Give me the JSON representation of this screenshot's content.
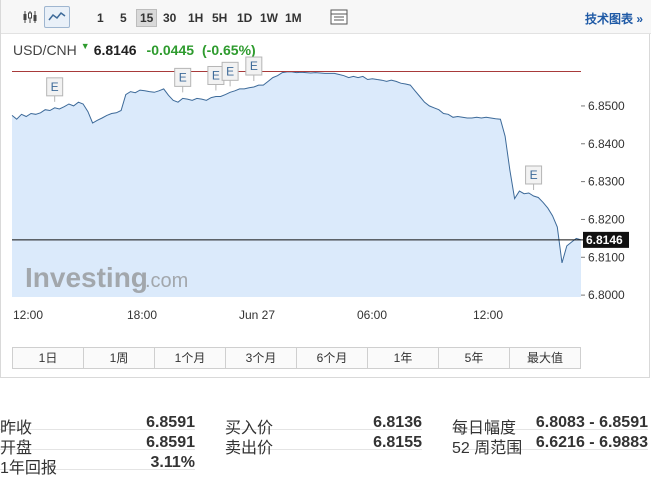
{
  "toolbar": {
    "timeframes": [
      "1",
      "5",
      "15",
      "30",
      "1H",
      "5H",
      "1D",
      "1W",
      "1M"
    ],
    "active_timeframe": "15",
    "tech_chart_link": "技术图表 »"
  },
  "quote": {
    "symbol": "USD/CNH",
    "price": "6.8146",
    "change": "-0.0445",
    "change_pct": "(-0.65%)",
    "up_color": "#2e9b2e"
  },
  "watermark": {
    "brand": "Investing",
    "suffix": ".com"
  },
  "ranges": [
    "1日",
    "1周",
    "1个月",
    "3个月",
    "6个月",
    "1年",
    "5年",
    "最大值"
  ],
  "chart_data": {
    "type": "area",
    "x_ticks": [
      "12:00",
      "18:00",
      "Jun 27",
      "06:00",
      "12:00"
    ],
    "y_ticks": [
      "6.8500",
      "6.8400",
      "6.8300",
      "6.8200",
      "6.8100",
      "6.8000"
    ],
    "ylim": [
      6.7995,
      6.8595
    ],
    "prev_close": 6.8591,
    "current_label": "6.8146",
    "event_marker_label": "E",
    "event_markers": [
      9,
      36,
      43,
      46,
      51,
      110
    ],
    "fill_color": "#dbeafb",
    "line_color": "#3d6a99",
    "prev_close_color": "#a83a3a",
    "grid": false,
    "series": [
      {
        "values": [
          6.8475,
          6.8465,
          6.8478,
          6.8472,
          6.848,
          6.8478,
          6.8482,
          6.849,
          6.8488,
          6.8495,
          6.8492,
          6.8498,
          6.8505,
          6.85,
          6.851,
          6.8505,
          6.8485,
          6.8455,
          6.8462,
          6.8468,
          6.8475,
          6.848,
          6.8482,
          6.8488,
          6.853,
          6.8538,
          6.8535,
          6.8542,
          6.854,
          6.8538,
          6.8536,
          6.854,
          6.8545,
          6.8528,
          6.8515,
          6.851,
          6.852,
          6.8518,
          6.8515,
          6.852,
          6.8518,
          6.8515,
          6.8522,
          6.8525,
          6.8525,
          6.853,
          6.8536,
          6.854,
          6.8545,
          6.8545,
          6.8548,
          6.855,
          6.8555,
          6.8555,
          6.8565,
          6.8575,
          6.858,
          6.8588,
          6.859,
          6.859,
          6.8588,
          6.8589,
          6.8588,
          6.8587,
          6.8588,
          6.8587,
          6.8586,
          6.8586,
          6.8586,
          6.8583,
          6.858,
          6.8575,
          6.8578,
          6.8575,
          6.8578,
          6.857,
          6.8572,
          6.857,
          6.8568,
          6.8565,
          6.8568,
          6.8565,
          6.856,
          6.8558,
          6.8555,
          6.854,
          6.8525,
          6.851,
          6.85,
          6.8495,
          6.849,
          6.848,
          6.8478,
          6.847,
          6.8472,
          6.847,
          6.8468,
          6.8468,
          6.847,
          6.8468,
          6.847,
          6.8468,
          6.8466,
          6.8465,
          6.842,
          6.833,
          6.8255,
          6.8275,
          6.8268,
          6.827,
          6.8262,
          6.8258,
          6.8245,
          6.823,
          6.821,
          6.818,
          6.8085,
          6.813,
          6.814,
          6.815,
          6.8146
        ]
      }
    ]
  },
  "stats": {
    "prev_close": {
      "label": "昨收",
      "value": "6.8591"
    },
    "open": {
      "label": "开盘",
      "value": "6.8591"
    },
    "year_change": {
      "label": "1年回报",
      "value": "3.11%"
    },
    "bid": {
      "label": "买入价",
      "value": "6.8136"
    },
    "ask": {
      "label": "卖出价",
      "value": "6.8155"
    },
    "day_range": {
      "label": "每日幅度",
      "value": "6.8083 - 6.8591"
    },
    "week52_range": {
      "label": "52 周范围",
      "value": "6.6216 - 6.9883"
    }
  }
}
